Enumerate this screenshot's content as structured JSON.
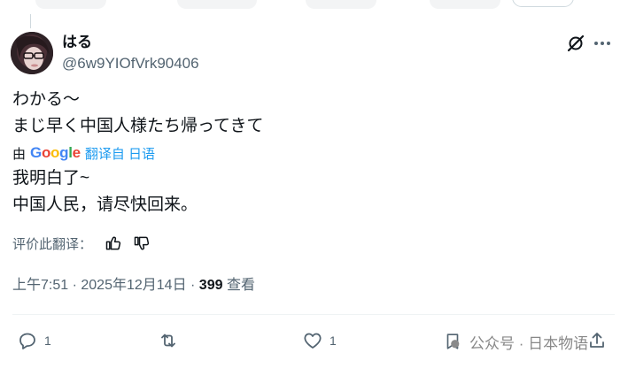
{
  "post": {
    "author": {
      "name": "はる",
      "handle": "@6w9YIOfVrk90406"
    },
    "original_text": [
      "わかる〜",
      "まじ早く中国人様たち帰ってきて"
    ],
    "translation": {
      "by_label": "由",
      "provider": "Google",
      "link_text": "翻译自 日语",
      "lines": [
        "我明白了~",
        "中国人民，请尽快回来。"
      ]
    },
    "rate_label": "评价此翻译：",
    "meta": {
      "time": "上午7:51",
      "sep": " · ",
      "date": "2025年12月14日",
      "sep2": " · ",
      "views": "399",
      "views_label": " 查看"
    },
    "actions": {
      "reply_count": "1",
      "like_count": "1"
    },
    "watermark": "公众号 · 日本物语"
  },
  "icons": {
    "grok": "grok-icon",
    "more": "more-icon",
    "thumbs_up": "thumbs-up-icon",
    "thumbs_down": "thumbs-down-icon",
    "reply": "reply-icon",
    "repost": "repost-icon",
    "like": "heart-icon",
    "bookmark": "bookmark-icon",
    "share": "share-icon"
  },
  "colors": {
    "text": "#0f1419",
    "secondary": "#536471",
    "link": "#1d9bf0",
    "divider": "#eff3f4"
  }
}
